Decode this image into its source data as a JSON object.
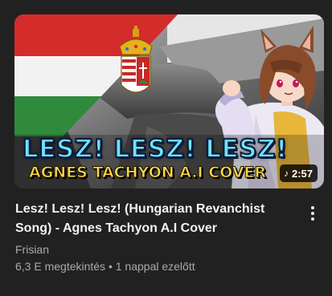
{
  "video": {
    "thumbnail_text_main": "LESZ! LESZ! LESZ!",
    "thumbnail_text_sub": "AGNES TACHYON A.I COVER",
    "duration": "2:57",
    "duration_icon": "music-note-icon",
    "title": "Lesz! Lesz! Lesz! (Hungarian Revanchist Song) - Agnes Tachyon A.I Cover",
    "channel": "Frisian",
    "views": "6,3 E megtekintés",
    "separator": "•",
    "age": "1 nappal ezelőtt"
  },
  "menu": {
    "icon": "more-vertical-icon"
  },
  "colors": {
    "background": "#212121",
    "title_text": "#f1f1f1",
    "secondary_text": "#aaaaaa",
    "flag_red": "#d42b2b",
    "flag_white": "#f2f2f2",
    "flag_green": "#2f8a3c",
    "thumb_text_main": "#6fe3ff",
    "thumb_text_sub": "#ffd84a"
  }
}
